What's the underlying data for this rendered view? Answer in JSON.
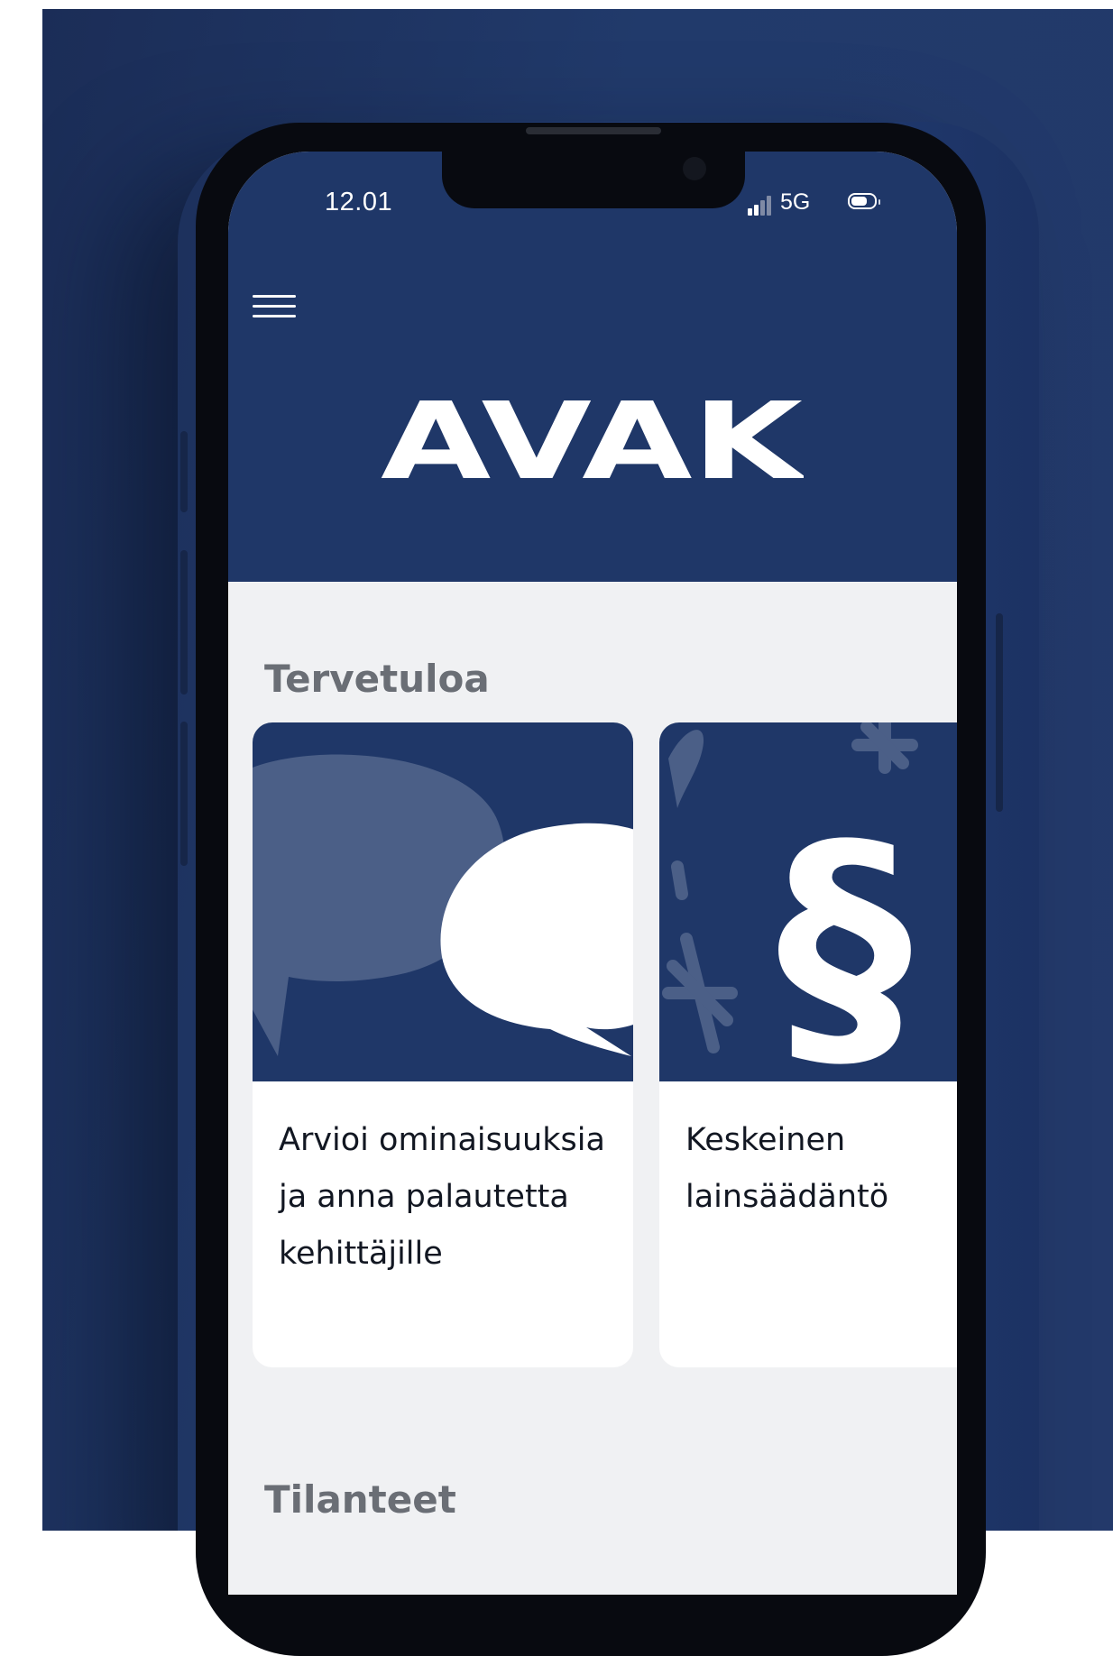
{
  "status_bar": {
    "time": "12.01",
    "network": "5G",
    "signal_icon": "cellular-signal-icon",
    "battery_icon": "battery-icon"
  },
  "header": {
    "menu_icon": "hamburger-menu-icon",
    "logo_text": "AVAK",
    "background_color": "#1f3768"
  },
  "welcome_section": {
    "title": "Tervetuloa",
    "cards": [
      {
        "label": "Arvioi ominaisuuksia ja anna palautetta kehittäjille",
        "icon": "speech-bubbles-icon"
      },
      {
        "label": "Keskeinen lainsäädäntö",
        "icon": "section-sign-icon"
      }
    ]
  },
  "situations_section": {
    "title": "Tilanteet"
  },
  "colors": {
    "brand_navy": "#1f3768",
    "screen_background": "#f0f1f3",
    "card_background": "#ffffff",
    "section_title": "#6a6e75"
  }
}
